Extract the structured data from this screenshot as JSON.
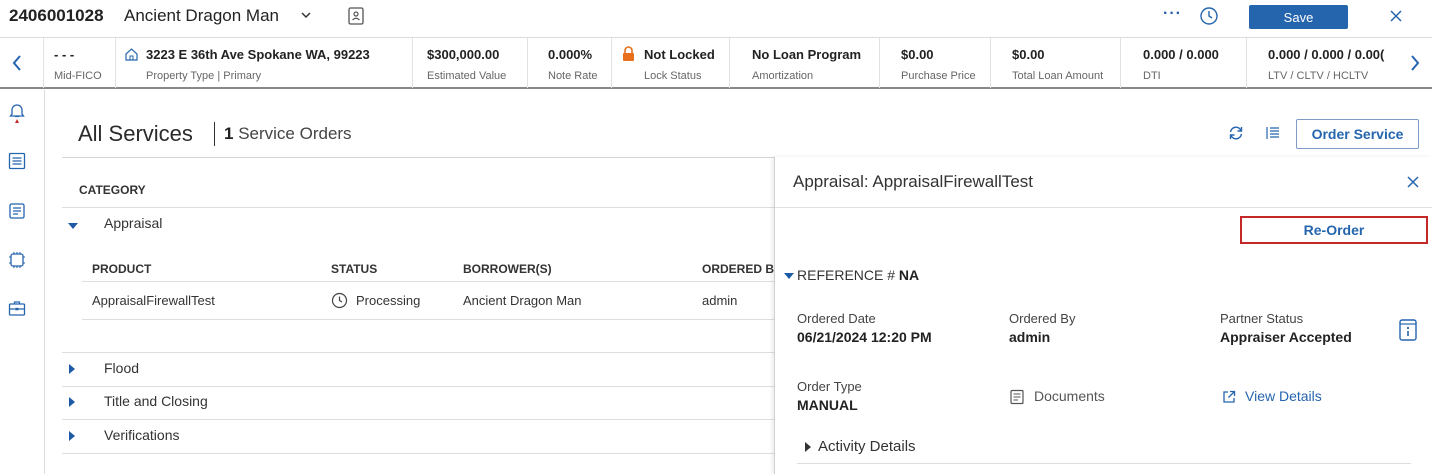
{
  "header": {
    "loan_number": "2406001028",
    "borrower_name": "Ancient Dragon Man",
    "more_label": "···",
    "save_label": "Save"
  },
  "summary": [
    {
      "value": "- - -",
      "label": "Mid-FICO"
    },
    {
      "value": "3223 E 36th Ave Spokane WA, 99223",
      "label": "Property Type | Primary"
    },
    {
      "value": "$300,000.00",
      "label": "Estimated Value"
    },
    {
      "value": "0.000%",
      "label": "Note Rate"
    },
    {
      "value": "Not Locked",
      "label": "Lock Status"
    },
    {
      "value": "No Loan Program",
      "label": "Amortization"
    },
    {
      "value": "$0.00",
      "label": "Purchase Price"
    },
    {
      "value": "$0.00",
      "label": "Total Loan Amount"
    },
    {
      "value": "0.000 / 0.000",
      "label": "DTI"
    },
    {
      "value": "0.000 / 0.000 / 0.00(",
      "label": "LTV / CLTV / HCLTV"
    }
  ],
  "main": {
    "title": "All Services",
    "order_count": "1",
    "order_count_suffix": " Service Orders",
    "order_service_label": "Order Service",
    "category_header": "CATEGORY",
    "categories": [
      {
        "label": "Appraisal",
        "expanded": true
      },
      {
        "label": "Flood",
        "expanded": false
      },
      {
        "label": "Title and Closing",
        "expanded": false
      },
      {
        "label": "Verifications",
        "expanded": false
      }
    ],
    "table": {
      "columns": [
        "PRODUCT",
        "STATUS",
        "BORROWER(S)",
        "ORDERED BY"
      ],
      "rows": [
        {
          "product": "AppraisalFirewallTest",
          "status": "Processing",
          "borrower": "Ancient Dragon Man",
          "ordered_by": "admin"
        }
      ]
    }
  },
  "panel": {
    "title": "Appraisal: AppraisalFirewallTest",
    "reorder_label": "Re-Order",
    "reference_prefix": "REFERENCE # ",
    "reference_value": "NA",
    "ordered_date_label": "Ordered Date",
    "ordered_date": "06/21/2024 12:20 PM",
    "ordered_by_label": "Ordered By",
    "ordered_by": "admin",
    "partner_status_label": "Partner Status",
    "partner_status": "Appraiser Accepted",
    "order_type_label": "Order Type",
    "order_type": "MANUAL",
    "documents_label": "Documents",
    "view_details_label": "View Details",
    "activity_label": "Activity Details"
  },
  "colors": {
    "accent": "#2565ae",
    "lock_icon": "#e8701a",
    "reorder_highlight": "#c62828"
  },
  "icons": [
    "chevron-down-icon",
    "contact-card-icon",
    "more-icon",
    "history-icon",
    "close-icon",
    "home-icon",
    "lock-icon",
    "bell-icon",
    "list-icon",
    "document-icon",
    "chip-icon",
    "briefcase-icon",
    "refresh-icon",
    "clock-icon",
    "info-icon",
    "external-link-icon"
  ]
}
